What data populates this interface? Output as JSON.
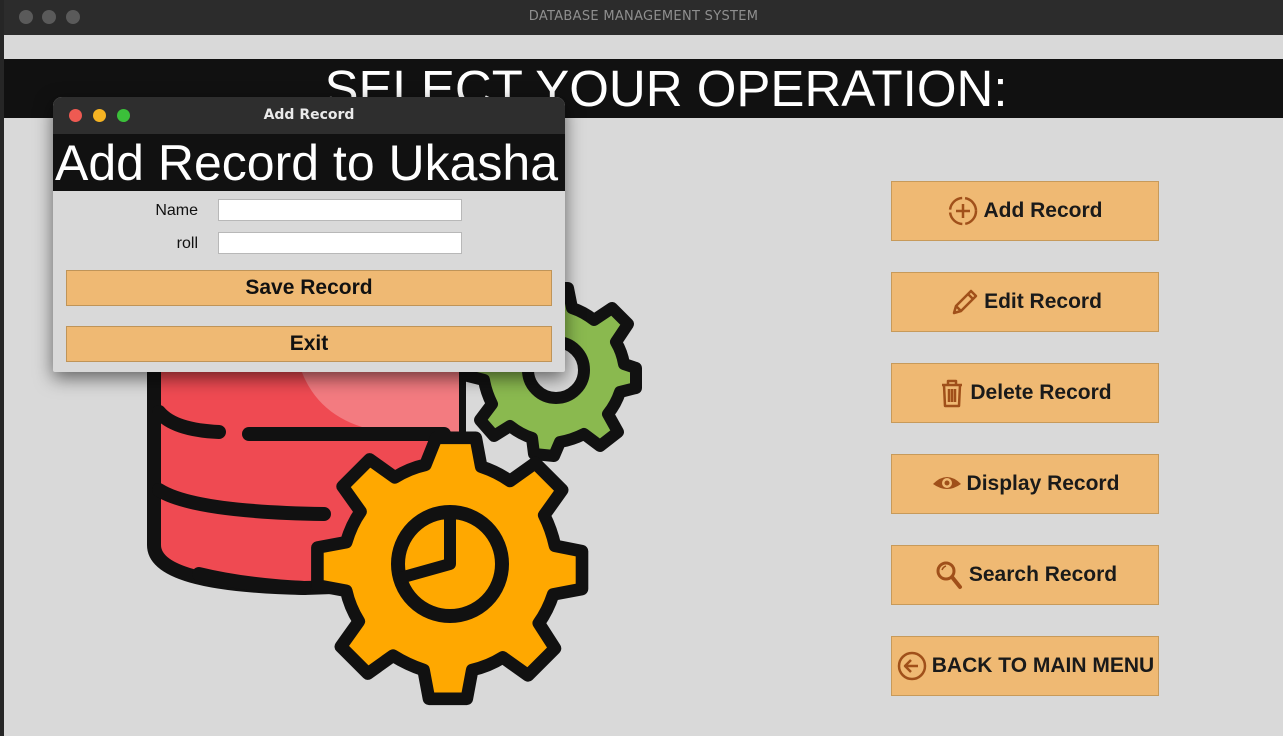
{
  "main_window": {
    "title": "DATABASE MANAGEMENT SYSTEM",
    "heading": "SELECT YOUR OPERATION:"
  },
  "operations": [
    {
      "label": "Add Record",
      "icon": "add-circle-icon"
    },
    {
      "label": "Edit Record",
      "icon": "pencil-icon"
    },
    {
      "label": "Delete Record",
      "icon": "trash-icon"
    },
    {
      "label": "Display Record",
      "icon": "eye-icon"
    },
    {
      "label": "Search Record",
      "icon": "magnifier-icon"
    },
    {
      "label": "BACK TO MAIN MENU",
      "icon": "back-arrow-icon"
    }
  ],
  "dialog": {
    "title": "Add Record",
    "heading": "Add Record to Ukasha",
    "fields": [
      {
        "label": "Name",
        "value": ""
      },
      {
        "label": "roll",
        "value": ""
      }
    ],
    "save_label": "Save Record",
    "exit_label": "Exit"
  },
  "colors": {
    "window_bg": "#d9d9d9",
    "banner_bg": "#111111",
    "button_bg": "#efb973",
    "icon_color": "#a0501a",
    "db_red": "#ef4a52",
    "gear_orange": "#ffa800",
    "gear_green": "#8ab94f"
  }
}
